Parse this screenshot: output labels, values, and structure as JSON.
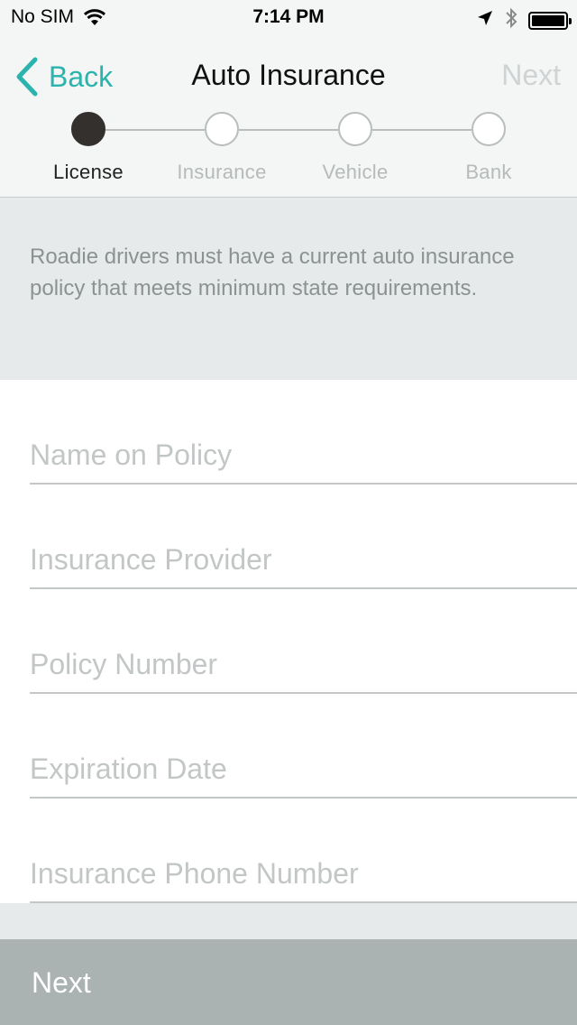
{
  "status_bar": {
    "carrier": "No SIM",
    "time": "7:14 PM"
  },
  "nav": {
    "back_label": "Back",
    "title": "Auto Insurance",
    "next_label": "Next"
  },
  "steps": [
    {
      "label": "License",
      "active": true
    },
    {
      "label": "Insurance",
      "active": false
    },
    {
      "label": "Vehicle",
      "active": false
    },
    {
      "label": "Bank",
      "active": false
    }
  ],
  "info_text": "Roadie drivers must have a current auto insurance policy that meets minimum state requirements.",
  "form": {
    "fields": [
      {
        "placeholder": "Name on Policy",
        "value": ""
      },
      {
        "placeholder": "Insurance Provider",
        "value": ""
      },
      {
        "placeholder": "Policy Number",
        "value": ""
      },
      {
        "placeholder": "Expiration Date",
        "value": ""
      },
      {
        "placeholder": "Insurance Phone Number",
        "value": ""
      }
    ]
  },
  "footer": {
    "next_button_label": "Next"
  },
  "colors": {
    "accent": "#2bb3ad",
    "active_step": "#33302d",
    "next_button_bg": "#aab2b2"
  }
}
